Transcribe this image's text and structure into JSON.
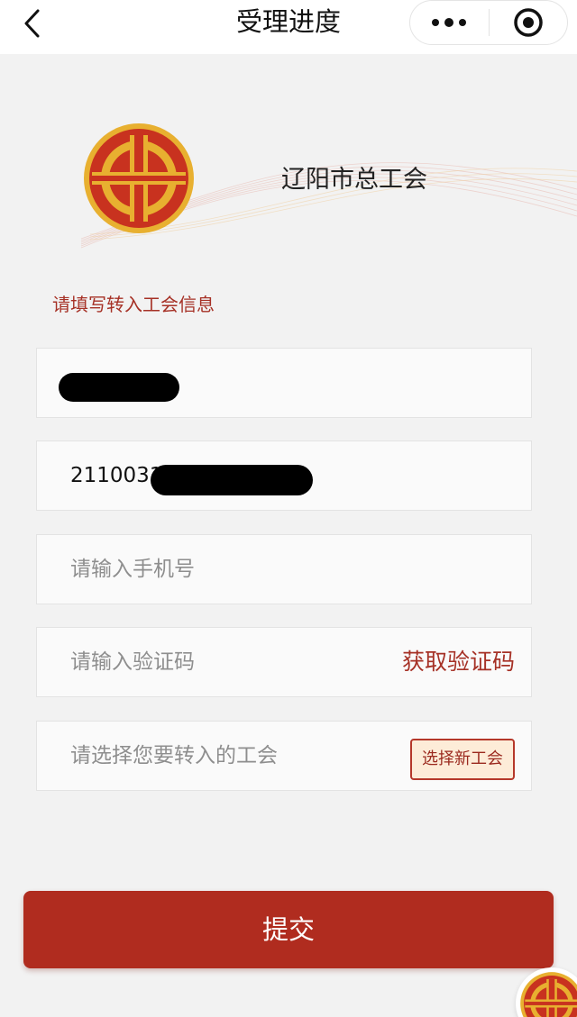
{
  "navbar": {
    "title": "受理进度",
    "back_icon": "chevron-left-icon",
    "more_icon": "more-dots-icon",
    "close_icon": "target-circle-icon"
  },
  "banner": {
    "org_name": "辽阳市总工会",
    "logo_icon": "union-emblem-icon"
  },
  "form": {
    "section_label": "请填写转入工会信息",
    "name_field": {
      "value": ""
    },
    "id_field": {
      "value": "2110031"
    },
    "phone_field": {
      "placeholder": "请输入手机号"
    },
    "code_field": {
      "placeholder": "请输入验证码",
      "action_label": "获取验证码"
    },
    "union_field": {
      "placeholder": "请选择您要转入的工会",
      "action_label": "选择新工会"
    }
  },
  "submit": {
    "label": "提交"
  },
  "colors": {
    "accent": "#a63126",
    "button": "#b02c1f",
    "emblem_red": "#c8321f",
    "emblem_gold": "#e8b030"
  }
}
